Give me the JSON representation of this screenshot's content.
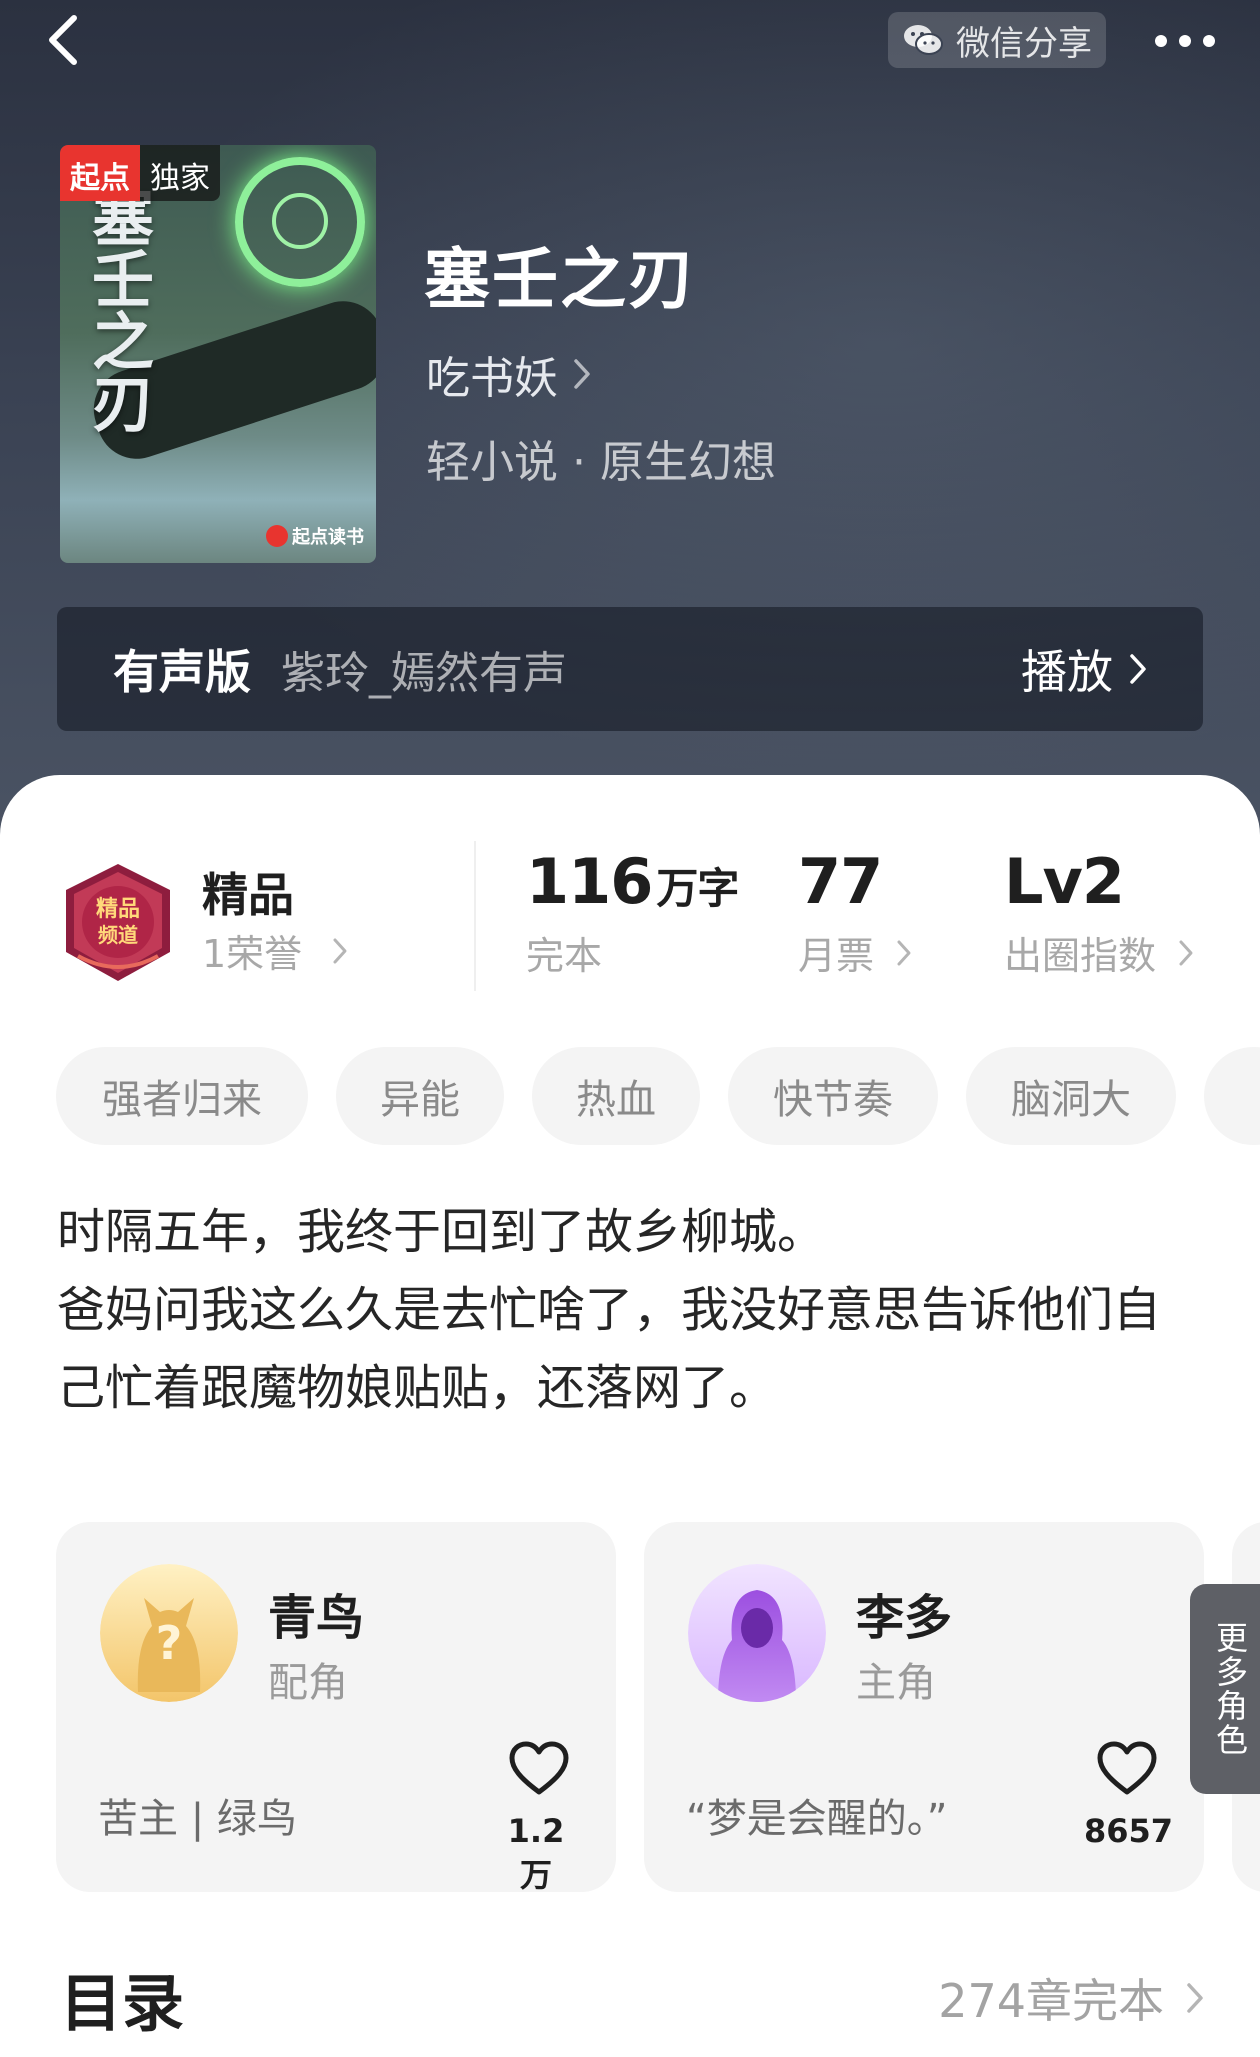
{
  "topbar": {
    "share_label": "微信分享"
  },
  "book": {
    "cover_badge_brand": "起点",
    "cover_badge_tag": "独家",
    "cover_title": "塞壬之刃",
    "cover_publisher": "起点读书",
    "title": "塞壬之刃",
    "author": "吃书妖",
    "category": "轻小说 · 原生幻想"
  },
  "audio": {
    "label": "有声版",
    "narrator": "紫玲_嫣然有声",
    "play_label": "播放"
  },
  "stats": {
    "honor_title": "精品",
    "honor_sub": "1荣誉",
    "words_value": "116",
    "words_unit": "万字",
    "words_status": "完本",
    "tickets_value": "77",
    "tickets_label": "月票",
    "index_value": "Lv2",
    "index_label": "出圈指数"
  },
  "tags": [
    "强者归来",
    "异能",
    "热血",
    "快节奏",
    "脑洞大"
  ],
  "synopsis": "时隔五年，我终于回到了故乡柳城。\n爸妈问我这么久是去忙啥了，我没好意思告诉他们自己忙着跟魔物娘贴贴，还落网了。",
  "characters": [
    {
      "name": "青鸟",
      "role": "配角",
      "quote": "苦主 | 绿鸟",
      "likes": "1.2万",
      "avatar": "question-avatar-icon"
    },
    {
      "name": "李多",
      "role": "主角",
      "quote": "“梦是会醒的。”",
      "likes": "8657",
      "avatar": "hooded-figure-avatar-icon"
    }
  ],
  "more_roles_label": "更多角色",
  "toc": {
    "title": "目录",
    "info": "274章完本"
  },
  "colors": {
    "hero_bg": "#333a48",
    "accent_red": "#e8342f",
    "tag_bg": "#f4f4f4"
  }
}
